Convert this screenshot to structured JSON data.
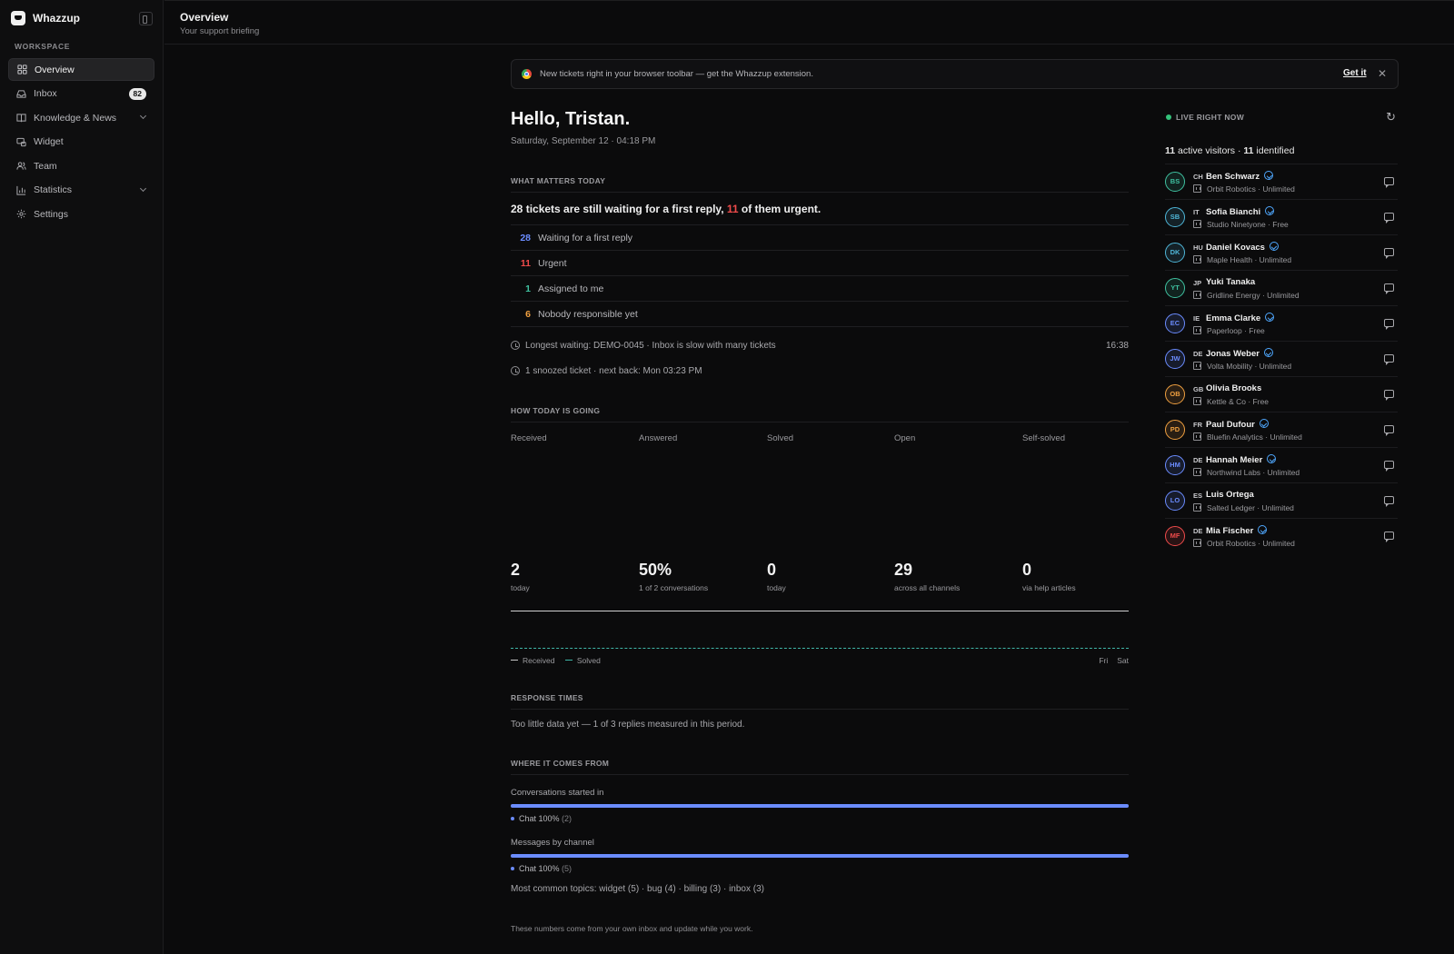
{
  "app": {
    "name": "Whazzup"
  },
  "sidebar": {
    "section_label": "WORKSPACE",
    "items": [
      {
        "label": "Overview",
        "icon": "grid-icon",
        "active": true
      },
      {
        "label": "Inbox",
        "icon": "inbox-icon",
        "badge": "82"
      },
      {
        "label": "Knowledge & News",
        "icon": "book-icon",
        "expandable": true
      },
      {
        "label": "Widget",
        "icon": "widget-icon"
      },
      {
        "label": "Team",
        "icon": "users-icon"
      },
      {
        "label": "Statistics",
        "icon": "bar-chart-icon",
        "expandable": true
      },
      {
        "label": "Settings",
        "icon": "gear-icon"
      }
    ]
  },
  "header": {
    "title": "Overview",
    "subtitle": "Your support briefing"
  },
  "banner": {
    "text": "New tickets right in your browser toolbar — get the Whazzup extension.",
    "link": "Get it",
    "close": "✕"
  },
  "greeting": {
    "title": "Hello, Tristan.",
    "date": "Saturday, September 12 · 04:18 PM"
  },
  "today": {
    "section": "WHAT MATTERS TODAY",
    "summary_count": "28",
    "summary_mid": " tickets are still waiting for a first reply, ",
    "summary_urgent": "11",
    "summary_end": " of them urgent.",
    "metrics": [
      {
        "value": "28",
        "label": "Waiting for a first reply",
        "color": "#6b8cff"
      },
      {
        "value": "11",
        "label": "Urgent",
        "color": "#ef4b4b"
      },
      {
        "value": "1",
        "label": "Assigned to me",
        "color": "#3fc1a0"
      },
      {
        "value": "6",
        "label": "Nobody responsible yet",
        "color": "#f0a040"
      }
    ],
    "longest_waiting": "Longest waiting: DEMO-0045 · Inbox is slow with many tickets",
    "longest_time": "16:38",
    "snoozed": "1 snoozed ticket · next back: Mon 03:23 PM"
  },
  "going": {
    "section": "HOW TODAY IS GOING",
    "stats": [
      {
        "head": "Received",
        "value": "2",
        "sub": "today"
      },
      {
        "head": "Answered",
        "value": "50%",
        "sub": "1 of 2 conversations"
      },
      {
        "head": "Solved",
        "value": "0",
        "sub": "today"
      },
      {
        "head": "Open",
        "value": "29",
        "sub": "across all channels"
      },
      {
        "head": "Self-solved",
        "value": "0",
        "sub": "via help articles"
      }
    ],
    "legend_received": "Received",
    "legend_solved": "Solved",
    "x_ticks": [
      "Fri",
      "Sat"
    ]
  },
  "response": {
    "section": "RESPONSE TIMES",
    "text": "Too little data yet — 1 of 3 replies measured in this period."
  },
  "origin": {
    "section": "WHERE IT COMES FROM",
    "conversations_label": "Conversations started in",
    "conversations_legend": "Chat  100%",
    "conversations_count": "(2)",
    "conversations_share": 1.0,
    "messages_label": "Messages by channel",
    "messages_legend": "Chat  100%",
    "messages_count": "(5)",
    "messages_share": 1.0,
    "topics": "Most common topics: widget (5) · bug (4) · billing (3) · inbox (3)",
    "footnote": "These numbers come from your own inbox and update while you work."
  },
  "live": {
    "label": "LIVE RIGHT NOW",
    "active_count": "11",
    "active_text": " active visitors · ",
    "identified_count": "11",
    "identified_text": " identified",
    "visitors": [
      {
        "initials": "BS",
        "country": "CH",
        "name": "Ben Schwarz",
        "company": "Orbit Robotics · Unlimited",
        "verified": true,
        "color": "#3fc1a0"
      },
      {
        "initials": "SB",
        "country": "IT",
        "name": "Sofia Bianchi",
        "company": "Studio Ninetyone · Free",
        "verified": true,
        "color": "#4fb6d8"
      },
      {
        "initials": "DK",
        "country": "HU",
        "name": "Daniel Kovacs",
        "company": "Maple Health · Unlimited",
        "verified": true,
        "color": "#4fb6d8"
      },
      {
        "initials": "YT",
        "country": "JP",
        "name": "Yuki Tanaka",
        "company": "Gridline Energy · Unlimited",
        "verified": false,
        "color": "#3fc1a0"
      },
      {
        "initials": "EC",
        "country": "IE",
        "name": "Emma Clarke",
        "company": "Paperloop · Free",
        "verified": true,
        "color": "#6b8cff"
      },
      {
        "initials": "JW",
        "country": "DE",
        "name": "Jonas Weber",
        "company": "Volta Mobility · Unlimited",
        "verified": true,
        "color": "#6b8cff"
      },
      {
        "initials": "OB",
        "country": "GB",
        "name": "Olivia Brooks",
        "company": "Kettle & Co · Free",
        "verified": false,
        "color": "#f0a040"
      },
      {
        "initials": "PD",
        "country": "FR",
        "name": "Paul Dufour",
        "company": "Bluefin Analytics · Unlimited",
        "verified": true,
        "color": "#f0a040"
      },
      {
        "initials": "HM",
        "country": "DE",
        "name": "Hannah Meier",
        "company": "Northwind Labs · Unlimited",
        "verified": true,
        "color": "#6b8cff"
      },
      {
        "initials": "LO",
        "country": "ES",
        "name": "Luis Ortega",
        "company": "Salted Ledger · Unlimited",
        "verified": false,
        "color": "#6b8cff"
      },
      {
        "initials": "MF",
        "country": "DE",
        "name": "Mia Fischer",
        "company": "Orbit Robotics · Unlimited",
        "verified": true,
        "color": "#ef4b4b"
      }
    ]
  }
}
